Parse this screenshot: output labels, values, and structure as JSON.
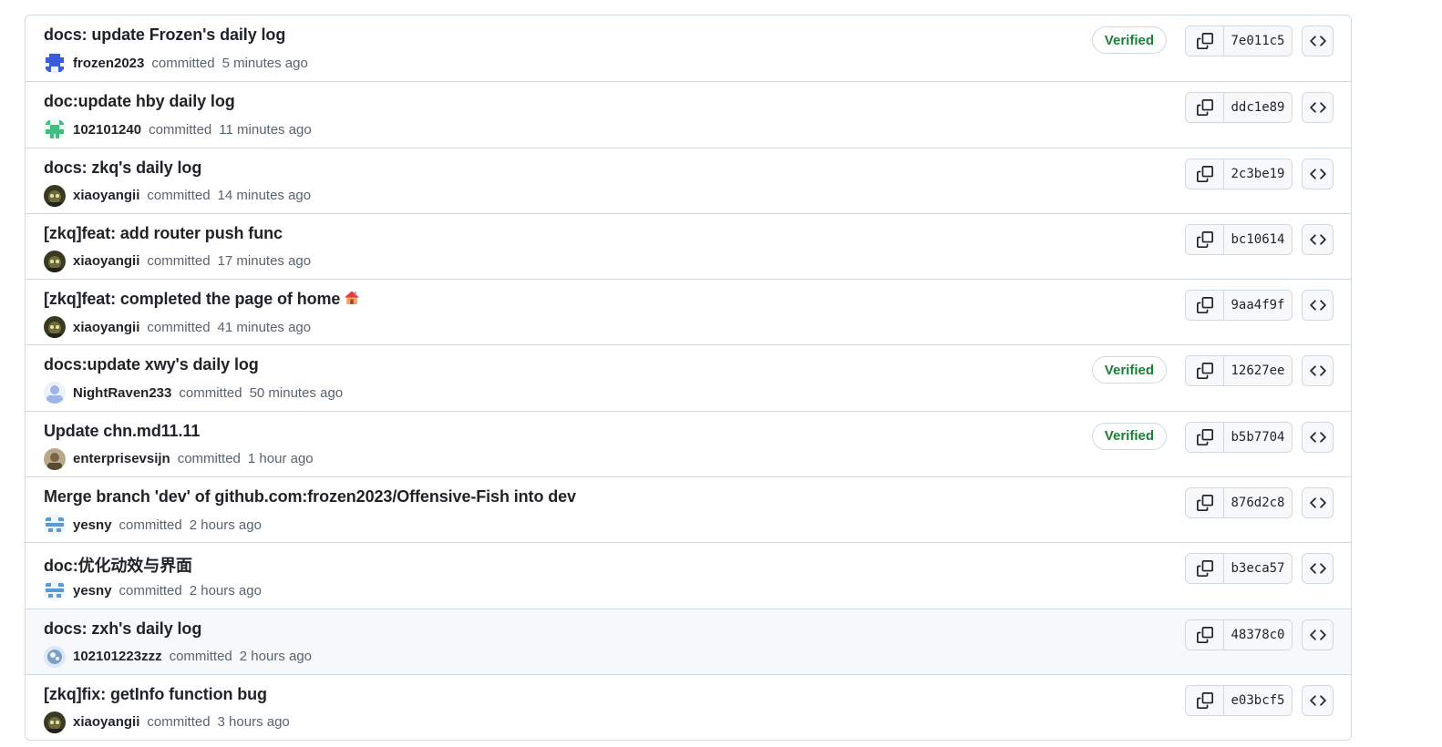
{
  "commits": [
    {
      "title": "docs: update Frozen's daily log",
      "author": "frozen2023",
      "verb": "committed",
      "time": "5 minutes ago",
      "verified": "Verified",
      "sha": "7e011c5",
      "avatar_color": "#3b5bdb"
    },
    {
      "title": "doc:update hby daily log",
      "author": "102101240",
      "verb": "committed",
      "time": "11 minutes ago",
      "verified": "",
      "sha": "ddc1e89",
      "avatar_color": "#3fbf7f"
    },
    {
      "title": "docs: zkq's daily log",
      "author": "xiaoyangii",
      "verb": "committed",
      "time": "14 minutes ago",
      "verified": "",
      "sha": "2c3be19",
      "avatar_color": "#4a4a2a"
    },
    {
      "title": "[zkq]feat: add router push func",
      "author": "xiaoyangii",
      "verb": "committed",
      "time": "17 minutes ago",
      "verified": "",
      "sha": "bc10614",
      "avatar_color": "#4a4a2a"
    },
    {
      "title": "[zkq]feat: completed the page of home",
      "author": "xiaoyangii",
      "verb": "committed",
      "time": "41 minutes ago",
      "verified": "",
      "sha": "9aa4f9f",
      "avatar_color": "#4a4a2a"
    },
    {
      "title": "docs:update xwy's daily log",
      "author": "NightRaven233",
      "verb": "committed",
      "time": "50 minutes ago",
      "verified": "Verified",
      "sha": "12627ee",
      "avatar_color": "#9fb4e8"
    },
    {
      "title": "Update chn.md11.11",
      "author": "enterprisevsijn",
      "verb": "committed",
      "time": "1 hour ago",
      "verified": "Verified",
      "sha": "b5b7704",
      "avatar_color": "#8a7a5a"
    },
    {
      "title": "Merge branch 'dev' of github.com:frozen2023/Offensive-Fish into dev",
      "author": "yesny",
      "verb": "committed",
      "time": "2 hours ago",
      "verified": "",
      "sha": "876d2c8",
      "avatar_color": "#5b9bd5"
    },
    {
      "title": "doc:优化动效与界面",
      "author": "yesny",
      "verb": "committed",
      "time": "2 hours ago",
      "verified": "",
      "sha": "b3eca57",
      "avatar_color": "#5b9bd5"
    },
    {
      "title": "docs: zxh's daily log",
      "author": "102101223zzz",
      "verb": "committed",
      "time": "2 hours ago",
      "verified": "",
      "sha": "48378c0",
      "avatar_color": "#7aa0c8"
    },
    {
      "title": "[zkq]fix: getInfo function bug",
      "author": "xiaoyangii",
      "verb": "committed",
      "time": "3 hours ago",
      "verified": "",
      "sha": "e03bcf5",
      "avatar_color": "#4a4a2a"
    }
  ],
  "icons": {
    "copy": "copy-icon",
    "browse": "code-icon",
    "house": "house-emoji-icon"
  },
  "colors": {
    "verified": "#1a7f37",
    "border": "#d1d9e0",
    "muted": "#59636e"
  }
}
